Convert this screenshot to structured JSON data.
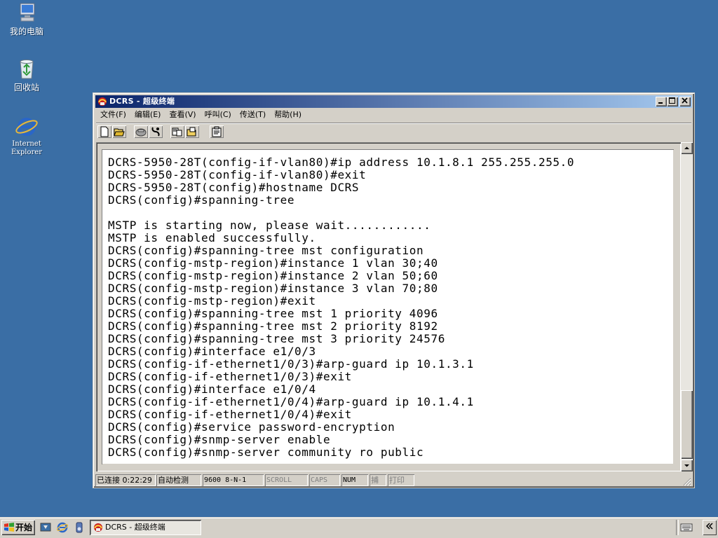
{
  "desktop": {
    "icons": [
      {
        "label": "我的电脑",
        "icon": "my-computer-icon"
      },
      {
        "label": "回收站",
        "icon": "recycle-bin-icon"
      },
      {
        "label": "Internet\nExplorer",
        "icon": "internet-explorer-icon"
      }
    ]
  },
  "window": {
    "title": "DCRS - 超级终端",
    "menu": [
      "文件(F)",
      "编辑(E)",
      "查看(V)",
      "呼叫(C)",
      "传送(T)",
      "帮助(H)"
    ],
    "toolbar_icons": [
      "new-icon",
      "open-icon",
      "connect-icon",
      "disconnect-icon",
      "send-icon",
      "receive-icon",
      "properties-icon"
    ],
    "terminal_lines": [
      "DCRS-5950-28T(config-if-vlan80)#ip address 10.1.8.1 255.255.255.0",
      "DCRS-5950-28T(config-if-vlan80)#exit",
      "DCRS-5950-28T(config)#hostname DCRS",
      "DCRS(config)#spanning-tree",
      "",
      "MSTP is starting now, please wait............",
      "MSTP is enabled successfully.",
      "DCRS(config)#spanning-tree mst configuration",
      "DCRS(config-mstp-region)#instance 1 vlan 30;40",
      "DCRS(config-mstp-region)#instance 2 vlan 50;60",
      "DCRS(config-mstp-region)#instance 3 vlan 70;80",
      "DCRS(config-mstp-region)#exit",
      "DCRS(config)#spanning-tree mst 1 priority 4096",
      "DCRS(config)#spanning-tree mst 2 priority 8192",
      "DCRS(config)#spanning-tree mst 3 priority 24576",
      "DCRS(config)#interface e1/0/3",
      "DCRS(config-if-ethernet1/0/3)#arp-guard ip 10.1.3.1",
      "DCRS(config-if-ethernet1/0/3)#exit",
      "DCRS(config)#interface e1/0/4",
      "DCRS(config-if-ethernet1/0/4)#arp-guard ip 10.1.4.1",
      "DCRS(config-if-ethernet1/0/4)#exit",
      "DCRS(config)#service password-encryption",
      "DCRS(config)#snmp-server enable",
      "DCRS(config)#snmp-server community ro public"
    ],
    "status": {
      "connected": "已连接 0:22:29",
      "detect": "自动检测",
      "settings": "9600 8-N-1",
      "scroll": "SCROLL",
      "caps": "CAPS",
      "num": "NUM",
      "capture": "捕",
      "print": "打印"
    }
  },
  "taskbar": {
    "start_label": "开始",
    "quick_launch": [
      "show-desktop-icon",
      "ie-quicklaunch-icon",
      "media-player-icon"
    ],
    "task_label": "DCRS - 超级终端"
  },
  "colors": {
    "desktop": "#3a6ea5",
    "title_active_start": "#0a246a",
    "title_active_end": "#a6caf0",
    "face": "#d4d0c8"
  }
}
